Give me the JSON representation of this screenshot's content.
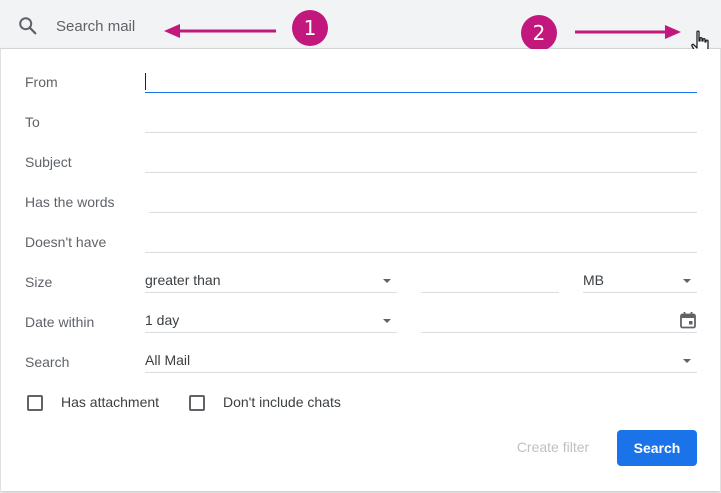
{
  "search": {
    "placeholder": "Search mail"
  },
  "annotations": {
    "badge1": "1",
    "badge2": "2",
    "color": "#c2187e"
  },
  "form": {
    "from_label": "From",
    "to_label": "To",
    "subject_label": "Subject",
    "has_words_label": "Has the words",
    "doesnt_have_label": "Doesn't have",
    "size_label": "Size",
    "size_operator": "greater than",
    "size_unit": "MB",
    "date_within_label": "Date within",
    "date_within_value": "1 day",
    "search_scope_label": "Search",
    "search_scope_value": "All Mail",
    "has_attachment_label": "Has attachment",
    "dont_include_chats_label": "Don't include chats"
  },
  "buttons": {
    "create_filter": "Create filter",
    "search": "Search"
  },
  "colors": {
    "primary": "#1a73e8",
    "disabled_text": "#bdc1c6",
    "annotation": "#c2187e"
  }
}
